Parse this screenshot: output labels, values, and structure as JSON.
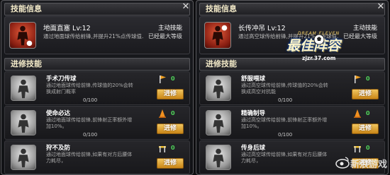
{
  "left_panel": {
    "section_skill_info": "技能信息",
    "section_train_skills": "进修技能",
    "close_label": "✕",
    "active_skill": {
      "title": "地面直塞 Lv:12",
      "desc": "通过地面球传给前锋,并提升21%点传球值.",
      "type": "主动技能",
      "status": "已经最大等级"
    },
    "train_skills": [
      {
        "name": "手术刀传球",
        "desc": "通过地面球传给前锋,传球值的20%会转换成射门概率",
        "progress": "0/100",
        "cost": "0",
        "button": "进修"
      },
      {
        "name": "使命必达",
        "desc": "通过地面球传给前锋,前锋射正率额外增加10%。",
        "progress": "0/100",
        "cost": "0",
        "button": "进修"
      },
      {
        "name": "狩不及防",
        "desc": "通过地面球传给前锋,如果有对方后腰体力耗尽，",
        "progress": "0/100",
        "cost": "0",
        "button": "进修"
      }
    ]
  },
  "right_panel": {
    "section_skill_info": "技能信息",
    "section_train_skills": "进修技能",
    "close_label": "✕",
    "active_skill": {
      "title": "长传冲吊 Lv:12",
      "desc": "通过高空球传给前锋,并提升21%点传球值.",
      "type": "主动技能",
      "status": "已经最大等级"
    },
    "train_skills": [
      {
        "name": "舒服喂球",
        "desc": "通过高空球传给前锋,传球值的20%会转换成高空对抗能",
        "progress": "0/100",
        "cost": "0",
        "button": "进修"
      },
      {
        "name": "精确制导",
        "desc": "通过高空球传给前锋,前锋射正率额外增加10%。",
        "progress": "0/100",
        "cost": "0",
        "button": "进修"
      },
      {
        "name": "传身后球",
        "desc": "通过高空球传给前锋,如果有对方后腰体力耗尽，",
        "progress": "0/100",
        "cost": "0",
        "button": "进修"
      }
    ]
  },
  "logo": {
    "top": "DREAM ELEVEN",
    "main": "最佳阵容",
    "url": "zjzr.37.com"
  },
  "watermark": {
    "text": "新浪游戏"
  },
  "colors": {
    "upgrade_button": "#e0a53a",
    "cost_value": "#4fd45a",
    "header_text": "#f2e9c8"
  }
}
